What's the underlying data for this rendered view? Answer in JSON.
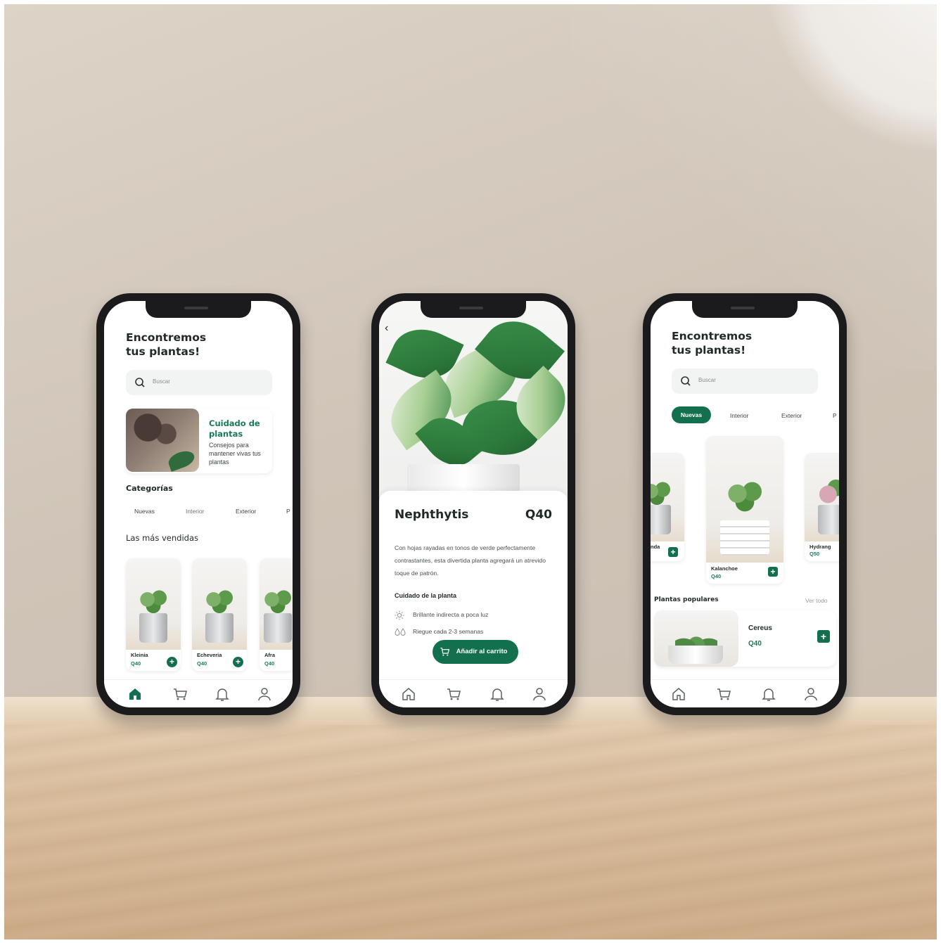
{
  "phone1": {
    "title_line1": "Encontremos",
    "title_line2": "tus plantas!",
    "search_placeholder": "Buscar",
    "care_title_line1": "Cuidado de",
    "care_title_line2": "plantas",
    "care_desc": "Consejos para mantener vivas tus plantas",
    "categories_heading": "Categorías",
    "categories": [
      "Nuevas",
      "Interior",
      "Exterior",
      "P"
    ],
    "bestsellers_heading": "Las más vendidas",
    "products": [
      {
        "name": "Kleinia",
        "price": "Q40"
      },
      {
        "name": "Echeveria",
        "price": "Q40"
      },
      {
        "name": "Afra",
        "price": "Q40"
      }
    ]
  },
  "phone2": {
    "name": "Nephthytis",
    "price": "Q40",
    "description": "Con hojas rayadas en tonos de verde perfectamente contrastantes, esta divertida planta agregará un atrevido toque de patrón.",
    "care_heading": "Cuidado de la planta",
    "care_light": "Brillante indirecta a poca luz",
    "care_water": "Riegue cada 2-3 semanas",
    "cart_button": "Añadir al carrito"
  },
  "phone3": {
    "title_line1": "Encontremos",
    "title_line2": "tus plantas!",
    "search_placeholder": "Buscar",
    "categories": [
      "Nuevas",
      "Interior",
      "Exterior",
      "P"
    ],
    "carousel": [
      {
        "name": "nda",
        "price": ""
      },
      {
        "name": "Kalanchoe",
        "price": "Q40"
      },
      {
        "name": "Hydrang",
        "price": "Q50"
      }
    ],
    "popular_heading": "Plantas populares",
    "see_all": "Ver todo",
    "popular_item": {
      "name": "Cereus",
      "price": "Q40"
    }
  },
  "colors": {
    "accent": "#13704f",
    "accent_text": "#1a7a58"
  },
  "icons": [
    "search-icon",
    "home-icon",
    "cart-icon",
    "bell-icon",
    "user-icon",
    "back-icon",
    "sun-icon",
    "water-drops-icon",
    "plus-icon"
  ]
}
